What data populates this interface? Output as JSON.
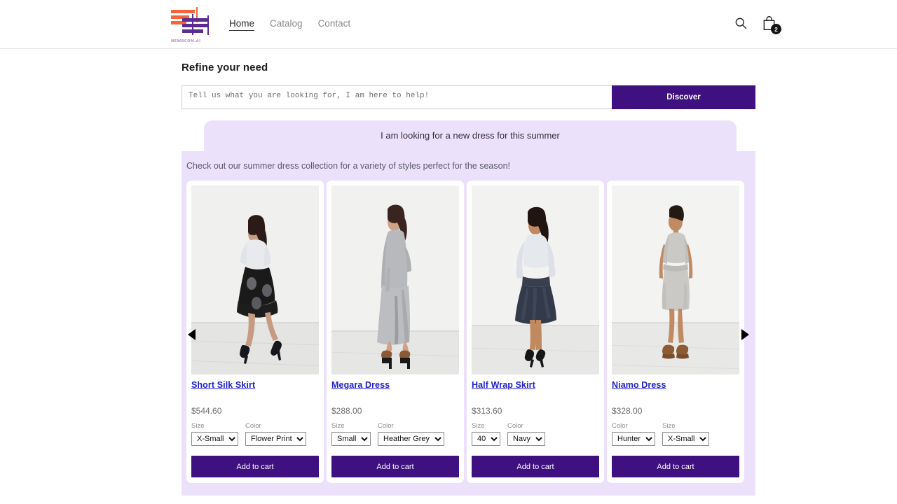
{
  "theme": {
    "accent_purple": "#3F107F",
    "panel_lavender": "#ECE1FB",
    "link_blue": "#2020CC",
    "logo_orange": "#F4663A",
    "logo_purple": "#5B2D8E"
  },
  "header": {
    "logo_text": "NEWBCOM.AI",
    "nav": [
      {
        "label": "Home",
        "active": true
      },
      {
        "label": "Catalog",
        "active": false
      },
      {
        "label": "Contact",
        "active": false
      }
    ],
    "search_icon": "search-icon",
    "cart_icon": "shopping-bag-icon",
    "cart_count": "2"
  },
  "refine": {
    "title": "Refine your need",
    "input_value": "",
    "input_placeholder": "Tell us what you are looking for, I am here to help!",
    "discover_label": "Discover"
  },
  "chat": {
    "user_message": "I am looking for a new dress for this summer",
    "assistant_message": "Check out our summer dress collection for a variety of styles perfect for the season!"
  },
  "carousel": {
    "prev_label": "◀",
    "next_label": "▶",
    "add_to_cart_label": "Add to cart",
    "products": [
      {
        "name": "Short Silk Skirt",
        "price": "$544.60",
        "image_alt": "model-in-white-top-and-black-printed-skirt",
        "variants": [
          {
            "label": "Size",
            "value": "X-Small"
          },
          {
            "label": "Color",
            "value": "Flower Print"
          }
        ]
      },
      {
        "name": "Megara Dress",
        "price": "$288.00",
        "image_alt": "model-in-grey-maxi-dress",
        "variants": [
          {
            "label": "Size",
            "value": "Small"
          },
          {
            "label": "Color",
            "value": "Heather Grey"
          }
        ]
      },
      {
        "name": "Half Wrap Skirt",
        "price": "$313.60",
        "image_alt": "model-in-white-lace-top-and-navy-pleated-skirt",
        "variants": [
          {
            "label": "Size",
            "value": "40"
          },
          {
            "label": "Color",
            "value": "Navy"
          }
        ]
      },
      {
        "name": "Niamo Dress",
        "price": "$328.00",
        "image_alt": "model-in-light-grey-fitted-dress",
        "variants": [
          {
            "label": "Color",
            "value": "Hunter"
          },
          {
            "label": "Size",
            "value": "X-Small"
          }
        ]
      }
    ]
  }
}
